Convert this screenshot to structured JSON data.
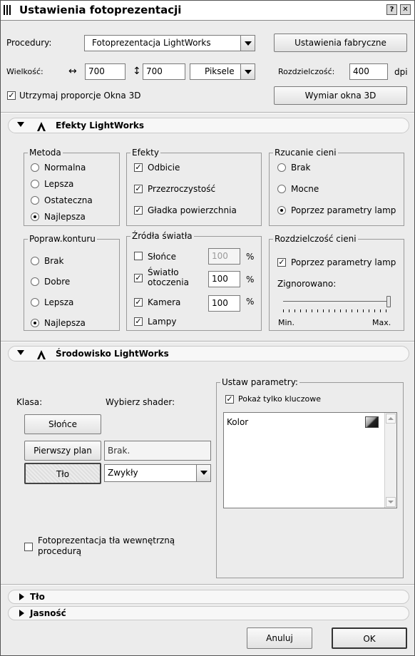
{
  "window": {
    "title": "Ustawienia fotoprezentacji",
    "help": "?",
    "close": "✕"
  },
  "top": {
    "procedures_label": "Procedury:",
    "procedure_value": "Fotoprezentacja LightWorks",
    "factory_button": "Ustawienia fabryczne",
    "size_label": "Wielkość:",
    "width_value": "700",
    "height_value": "700",
    "unit_value": "Piksele",
    "resolution_label": "Rozdzielczość:",
    "resolution_value": "400",
    "resolution_unit": "dpi",
    "keep_ratio_label": "Utrzymaj proporcje Okna 3D",
    "keep_ratio_checked": true,
    "window3d_button": "Wymiar okna 3D"
  },
  "effects_section": {
    "title": "Efekty LightWorks",
    "method": {
      "title": "Metoda",
      "options": [
        "Normalna",
        "Lepsza",
        "Ostateczna",
        "Najlepsza"
      ],
      "selected": 3
    },
    "effects": {
      "title": "Efekty",
      "items": [
        "Odbicie",
        "Przezroczystość",
        "Gładka powierzchnia"
      ],
      "checked": [
        true,
        true,
        true
      ]
    },
    "shadows": {
      "title": "Rzucanie cieni",
      "options": [
        "Brak",
        "Mocne",
        "Poprzez parametry lamp"
      ],
      "selected": 2
    },
    "contour": {
      "title": "Popraw.konturu",
      "options": [
        "Brak",
        "Dobre",
        "Lepsza",
        "Najlepsza"
      ],
      "selected": 3
    },
    "lights": {
      "title": "Źródła światła",
      "items": [
        {
          "label": "Słońce",
          "checked": false,
          "value": "100",
          "unit": "%"
        },
        {
          "label": "Światło otoczenia",
          "checked": true,
          "value": "100",
          "unit": "%"
        },
        {
          "label": "Kamera",
          "checked": true,
          "value": "100",
          "unit": "%"
        },
        {
          "label": "Lampy",
          "checked": true
        }
      ]
    },
    "shadow_res": {
      "title": "Rozdzielczość cieni",
      "checkbox_label": "Poprzez parametry lamp",
      "checked": true,
      "ignored_label": "Zignorowano:",
      "slider_level": 1.0,
      "min_label": "Min.",
      "max_label": "Max."
    }
  },
  "env_section": {
    "title": "Środowisko LightWorks",
    "class_label": "Klasa:",
    "shader_label": "Wybierz shader:",
    "btn_sun": "Słońce",
    "btn_fore": "Pierwszy plan",
    "btn_bg": "Tło",
    "fore_value": "Brak.",
    "bg_value": "Zwykły",
    "params_title": "Ustaw parametry:",
    "key_only_label": "Pokaż tylko kluczowe",
    "key_only_checked": true,
    "list_item": "Kolor",
    "internal_label_line1": "Fotoprezentacja tła wewnętrzną",
    "internal_label_line2": "procedurą",
    "internal_checked": false
  },
  "collapsed_sections": [
    "Tło",
    "Jasność"
  ],
  "footer": {
    "cancel": "Anuluj",
    "ok": "OK"
  }
}
